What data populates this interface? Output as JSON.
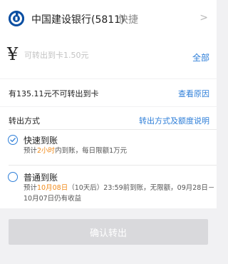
{
  "bank": {
    "name": "中国建设银行(5811)",
    "tag": "快捷"
  },
  "amount": {
    "currency_symbol": "¥",
    "placeholder": "可转出到卡1.50元",
    "all_label": "全部"
  },
  "info": {
    "text": "有135.11元不可转出到卡",
    "link": "查看原因"
  },
  "method": {
    "heading": "转出方式",
    "link": "转出方式及额度说明",
    "options": [
      {
        "title": "快速到账",
        "desc_prefix": "预计",
        "desc_highlight": "2小时",
        "desc_suffix": "内到账，每日限额1万元",
        "selected": true
      },
      {
        "title": "普通到账",
        "desc_prefix": "预计",
        "desc_highlight": "10月08日",
        "desc_suffix": "（10天后）23:59前到账，无限额，09月28日－",
        "desc_line2": "10月07日仍有收益",
        "selected": false
      }
    ]
  },
  "confirm_label": "确认转出",
  "colors": {
    "accent": "#2d7ed8",
    "highlight": "#f08a1a",
    "bank_logo": "#0b4fa2",
    "button_disabled": "#d9d9dc"
  },
  "icons": {
    "bank_logo": "ccb-logo-icon",
    "chevron": "chevron-right-icon",
    "radio_checked": "check-circle-icon",
    "radio_unchecked": "radio-empty-icon"
  }
}
